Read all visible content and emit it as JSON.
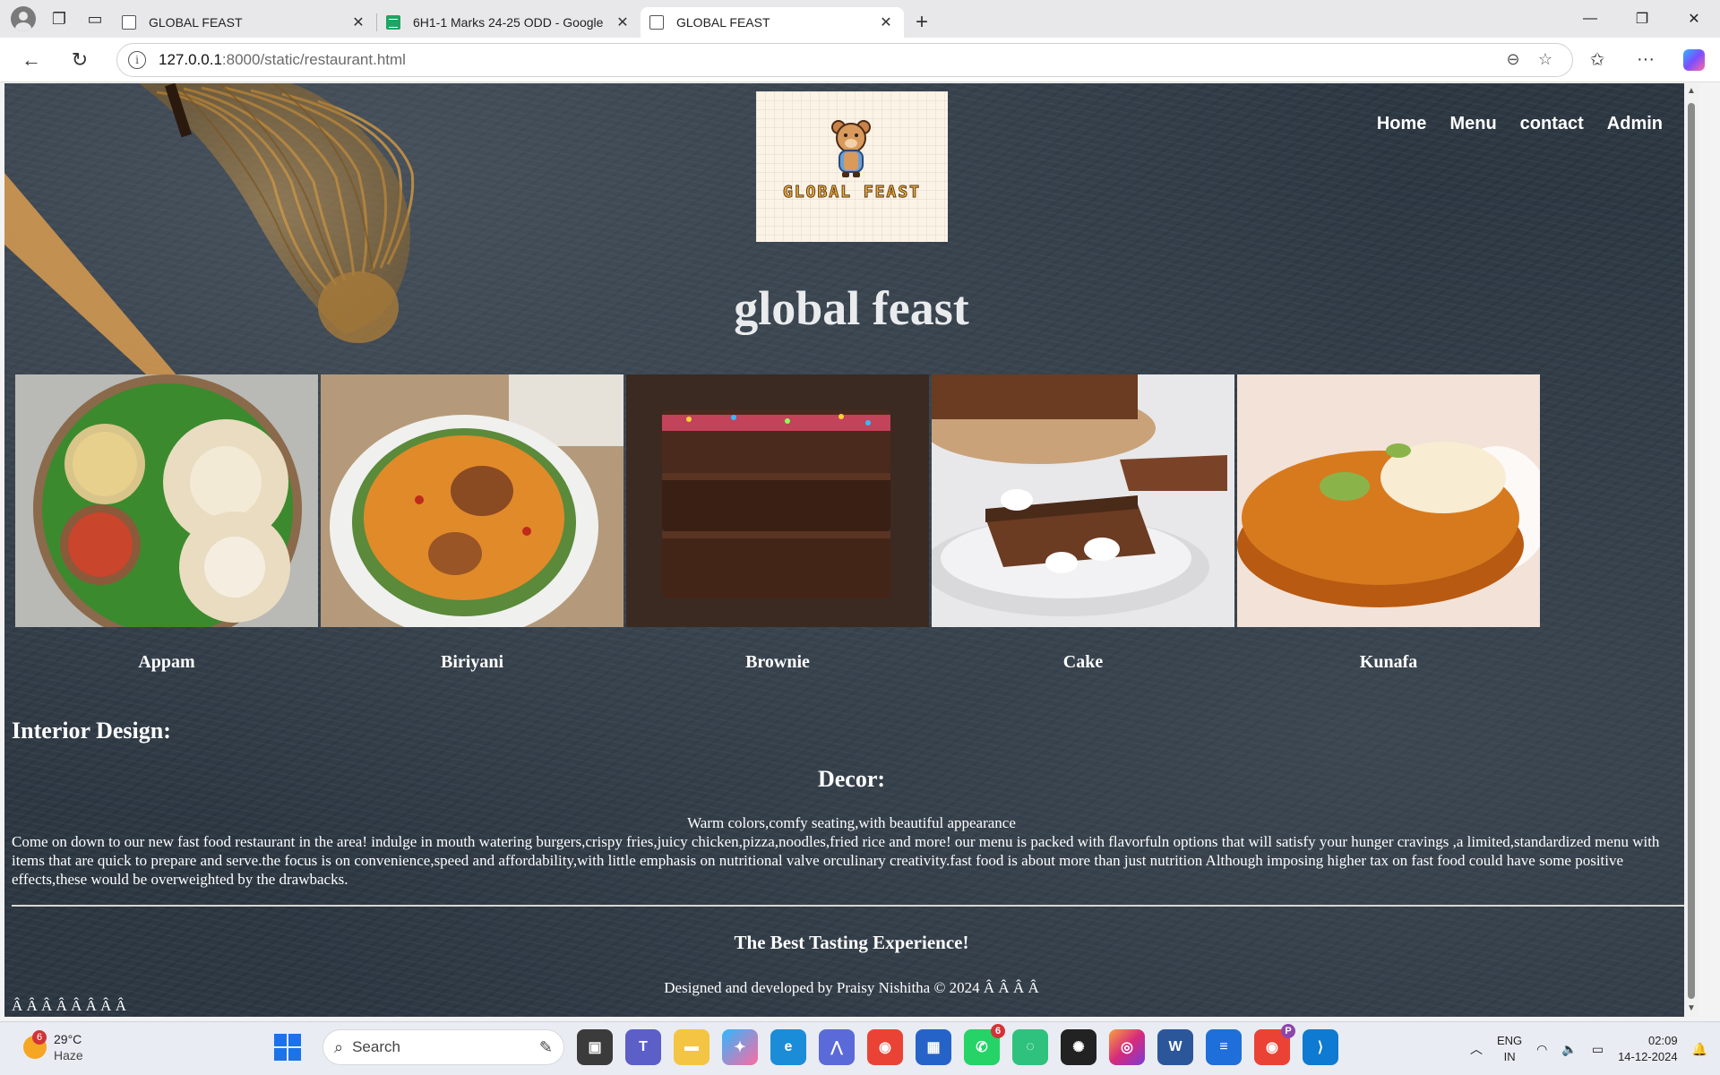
{
  "browser": {
    "tabs": [
      {
        "label": "GLOBAL FEAST",
        "favicon": "page-icon",
        "active": false
      },
      {
        "label": "6H1-1 Marks 24-25 ODD - Google",
        "favicon": "sheets-icon",
        "active": false
      },
      {
        "label": "GLOBAL FEAST",
        "favicon": "doc-icon",
        "active": true
      }
    ],
    "url_host": "127.0.0.1",
    "url_path": ":8000/static/restaurant.html"
  },
  "site": {
    "logo_text": "GLOBAL FEAST",
    "nav": [
      "Home",
      "Menu",
      "contact",
      "Admin"
    ],
    "title": "global feast",
    "dishes": [
      {
        "name": "Appam",
        "palette": [
          "#3c8a2e",
          "#e9dcc1",
          "#c9452b"
        ]
      },
      {
        "name": "Biriyani",
        "palette": [
          "#f0f0ee",
          "#e08a2a",
          "#5a8a3a"
        ]
      },
      {
        "name": "Brownie",
        "palette": [
          "#3a2a22",
          "#4a2a1c",
          "#e04a6a"
        ]
      },
      {
        "name": "Cake",
        "palette": [
          "#e8e8ea",
          "#6b3b22",
          "#ffffff"
        ]
      },
      {
        "name": "Kunafa",
        "palette": [
          "#f2e2d8",
          "#d77a1e",
          "#8ab44a"
        ]
      }
    ],
    "interior_heading": "Interior Design:",
    "decor_heading": "Decor:",
    "decor_text": "Warm colors,comfy seating,with beautiful appearance",
    "paragraph": "Come on down to our new fast food restaurant in the area! indulge in mouth watering burgers,crispy fries,juicy chicken,pizza,noodles,fried rice and more! our menu is packed with flavorfuln options that will satisfy your hunger cravings ,a limited,standardized menu with items that are quick to prepare and serve.the focus is on convenience,speed and affordability,with little emphasis on nutritional valve orculinary creativity.fast food is about more than just nutrition Although imposing higher tax on fast food could have some positive effects,these would be overweighted by the drawbacks.",
    "tagline": "The Best Tasting Experience!",
    "credits": "Designed and developed by Praisy Nishitha © 2024 Â Â Â Â",
    "stray_chars": "Â Â Â Â Â Â Â Â"
  },
  "taskbar": {
    "weather_badge": "6",
    "temperature": "29°C",
    "condition": "Haze",
    "search_placeholder": "Search",
    "whatsapp_badge": "6",
    "profile_badge": "P",
    "lang_line1": "ENG",
    "lang_line2": "IN",
    "time": "02:09",
    "date": "14-12-2024"
  }
}
